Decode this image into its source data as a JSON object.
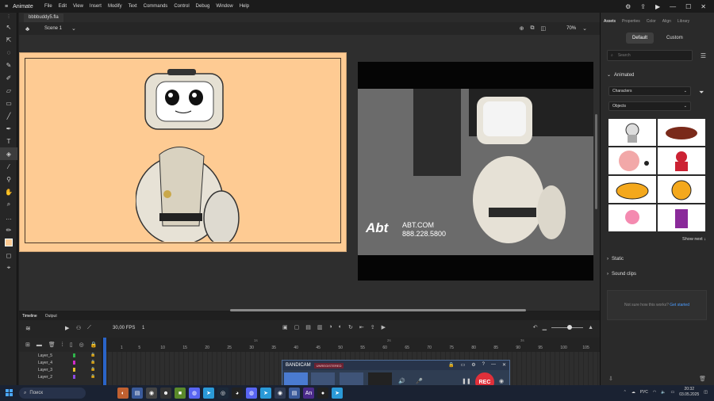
{
  "app": {
    "name": "Animate"
  },
  "menu": [
    "File",
    "Edit",
    "View",
    "Insert",
    "Modify",
    "Text",
    "Commands",
    "Control",
    "Debug",
    "Window",
    "Help"
  ],
  "document": {
    "tab": "bbbbuddy5.fla",
    "scene": "Scene 1",
    "zoom": "70%"
  },
  "video_overlay": {
    "brand": "Abt",
    "site": "ABT.COM",
    "phone": "888.228.5800"
  },
  "right_panel": {
    "tabs": [
      "Assets",
      "Properties",
      "Color",
      "Align",
      "Library"
    ],
    "segments": [
      "Default",
      "Custom"
    ],
    "search_placeholder": "Search",
    "sections": {
      "animated": "Animated",
      "static": "Static",
      "sound": "Sound clips"
    },
    "dropdowns": [
      "Characters",
      "Objects"
    ],
    "show_next": "Show next",
    "feedback": "Not sure how this works?",
    "feedback_link": "Get started"
  },
  "timeline": {
    "tabs": [
      "Timeline",
      "Output"
    ],
    "fps": "30,00",
    "fps_unit": "FPS",
    "frame": "1",
    "seconds": [
      "1s",
      "2s",
      "3s"
    ],
    "ruler": [
      "1",
      "5",
      "10",
      "15",
      "20",
      "25",
      "30",
      "35",
      "40",
      "45",
      "50",
      "55",
      "60",
      "65",
      "70",
      "75",
      "80",
      "85",
      "90",
      "95",
      "100",
      "105"
    ],
    "layers": [
      {
        "name": "Layer_5",
        "color": "#2fb34a"
      },
      {
        "name": "Layer_4",
        "color": "#d12bc9"
      },
      {
        "name": "Layer_3",
        "color": "#e6c42a"
      },
      {
        "name": "Layer_2",
        "color": "#8a4ae0"
      }
    ]
  },
  "bandicam": {
    "name": "BANDICAM",
    "badge": "UNREGISTERED",
    "rec": "REC"
  },
  "taskbar": {
    "search": "Поиск",
    "lang": "РУС",
    "time": "20:32",
    "date": "03.05.2025"
  }
}
